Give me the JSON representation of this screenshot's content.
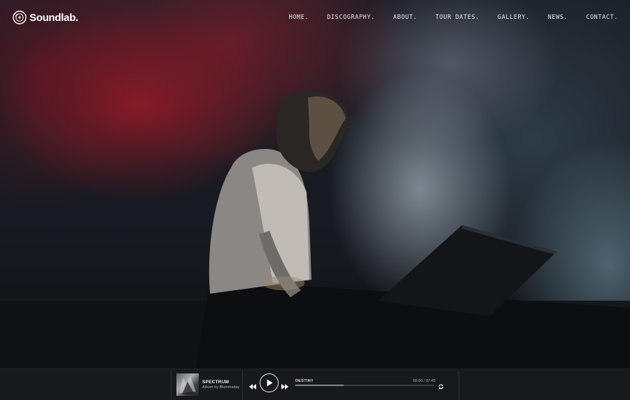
{
  "header": {
    "brand": "Soundlab.",
    "nav": [
      "HOME.",
      "DISCOGRAPHY.",
      "ABOUT.",
      "TOUR DATES.",
      "GALLERY.",
      "NEWS.",
      "CONTACT."
    ]
  },
  "player": {
    "track_title": "SPECTRUM",
    "track_album": "Album by Blummsday",
    "now_playing": "DESTINY",
    "time": "00:00 / 07:43",
    "progress": 0.35
  },
  "icons": {
    "logo": "vinyl-record-icon",
    "prev": "rewind-icon",
    "play": "play-icon",
    "next": "fast-forward-icon",
    "repeat": "repeat-icon"
  },
  "colors": {
    "background": "#121418",
    "player_bar": "#17191c",
    "smoke_red": "#a0192b",
    "smoke_blue": "#789baa"
  }
}
